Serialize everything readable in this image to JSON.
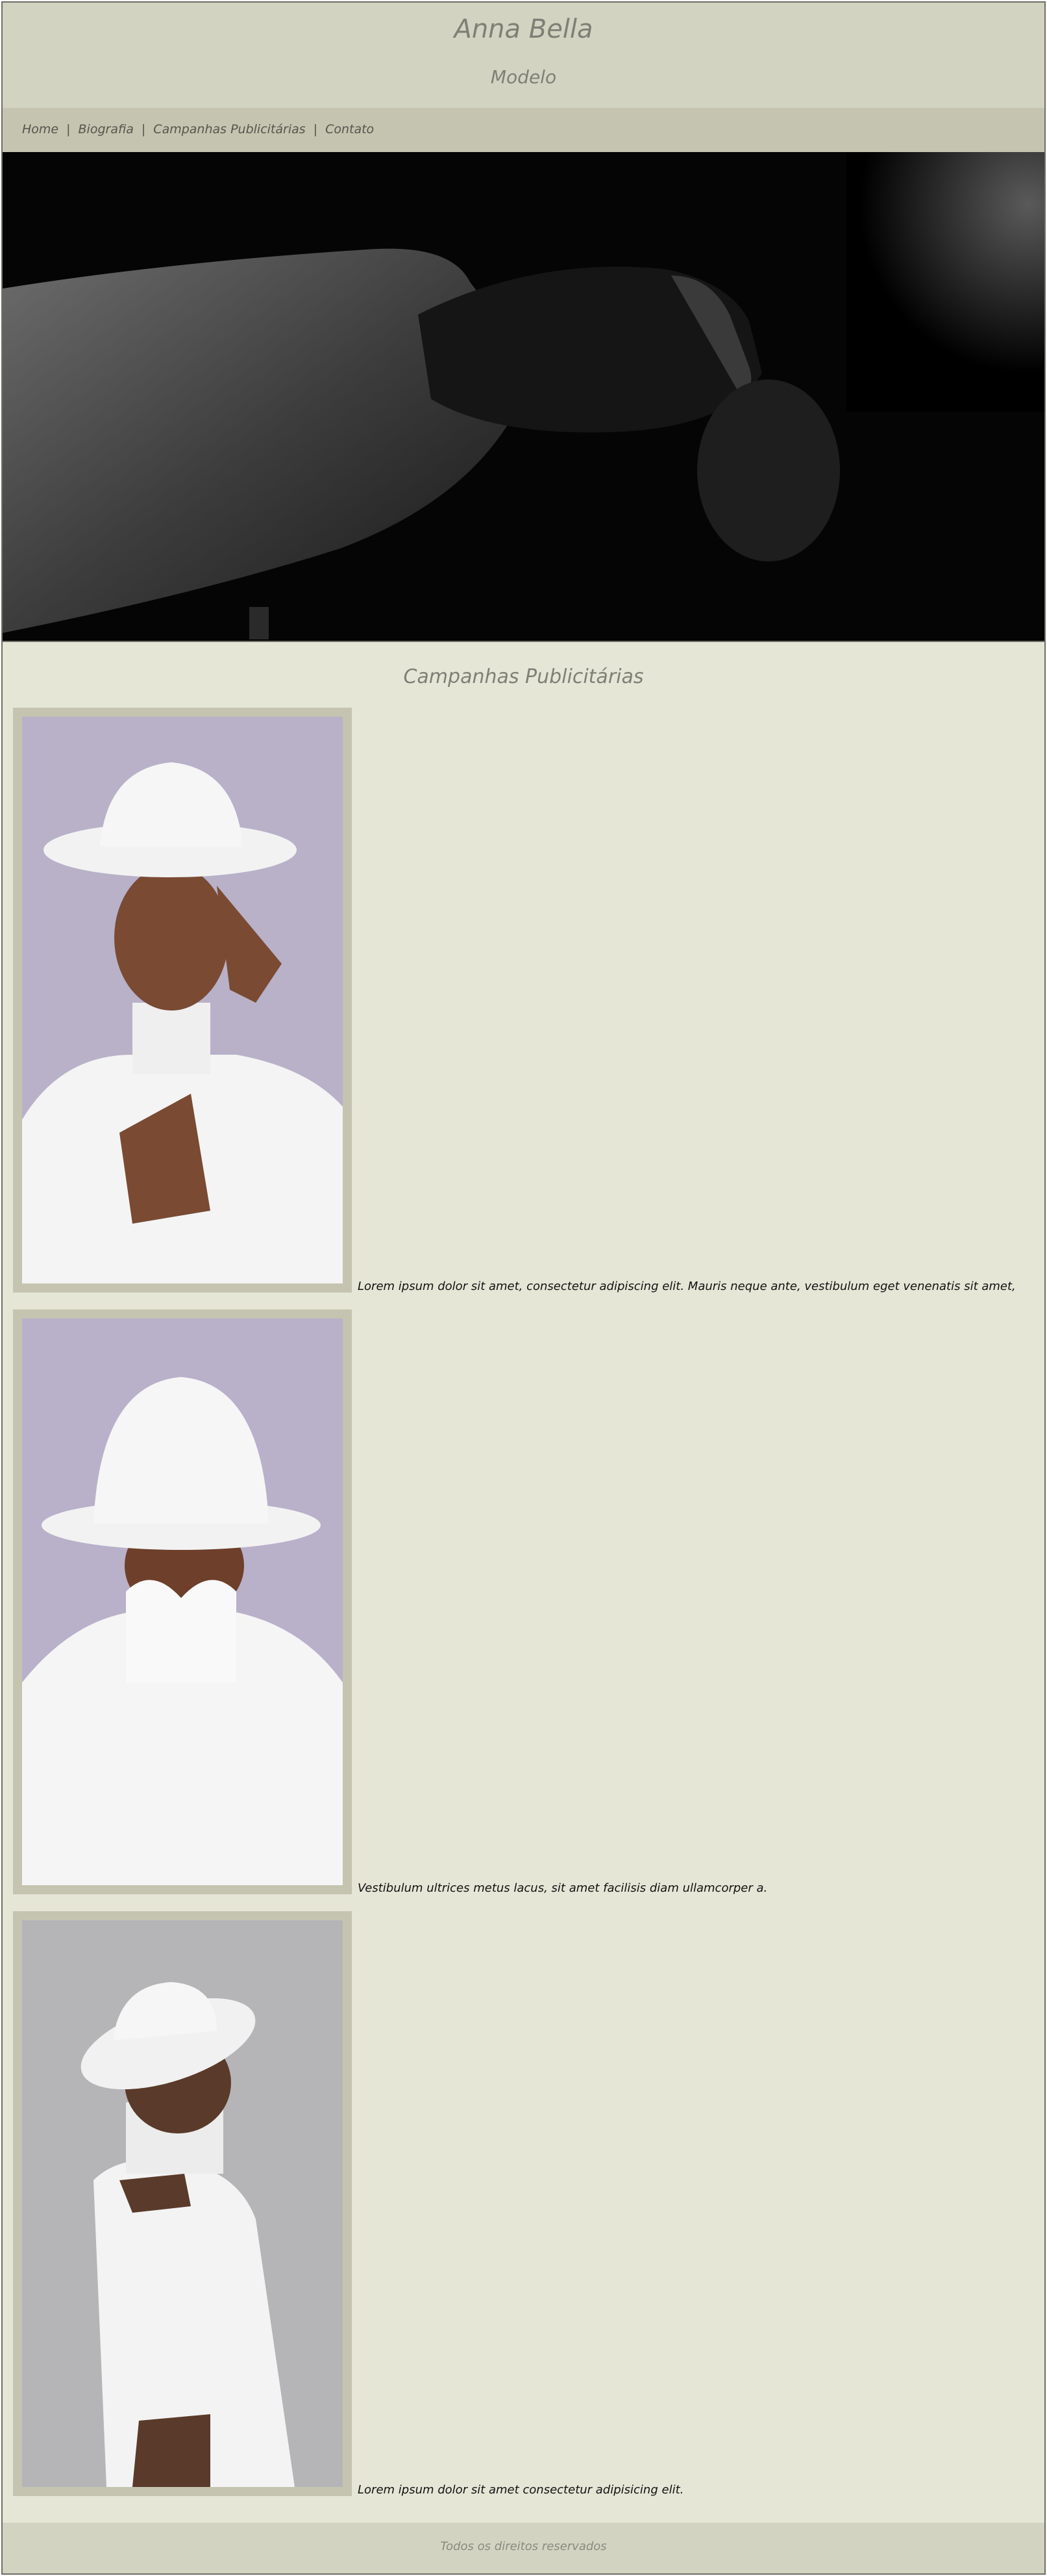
{
  "header": {
    "title": "Anna Bella",
    "subtitle": "Modelo"
  },
  "nav": {
    "items": [
      {
        "label": "Home"
      },
      {
        "label": "Biografia"
      },
      {
        "label": "Campanhas Publicitárias"
      },
      {
        "label": "Contato"
      }
    ],
    "separator": "|"
  },
  "section": {
    "title": "Campanhas Publicitárias"
  },
  "campaigns": [
    {
      "caption": "Lorem ipsum dolor sit amet, consectetur adipiscing elit. Mauris neque ante, vestibulum eget venenatis sit amet,"
    },
    {
      "caption": "Vestibulum ultrices metus lacus, sit amet facilisis diam ullamcorper a."
    },
    {
      "caption": "Lorem ipsum dolor sit amet consectetur adipisicing elit."
    }
  ],
  "footer": {
    "text": "Todos os direitos reservados"
  },
  "colors": {
    "page_bg": "#e6e6d7",
    "header_bg": "#d3d3c1",
    "nav_bg": "#c4c4b0",
    "title_text": "#7f7f76"
  }
}
